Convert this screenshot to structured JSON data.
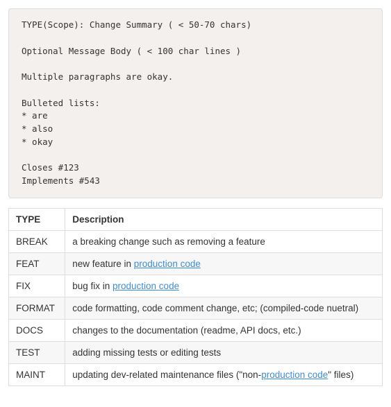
{
  "code_block": "TYPE(Scope): Change Summary ( < 50-70 chars)\n\nOptional Message Body ( < 100 char lines )\n\nMultiple paragraphs are okay.\n\nBulleted lists:\n* are\n* also\n* okay\n\nCloses #123\nImplements #543",
  "table": {
    "headers": {
      "type": "TYPE",
      "description": "Description"
    },
    "rows": [
      {
        "type": "BREAK",
        "desc_pre": "a breaking change such as removing a feature",
        "link": "",
        "desc_post": ""
      },
      {
        "type": "FEAT",
        "desc_pre": "new feature in ",
        "link": "production code",
        "desc_post": ""
      },
      {
        "type": "FIX",
        "desc_pre": "bug fix in ",
        "link": "production code",
        "desc_post": ""
      },
      {
        "type": "FORMAT",
        "desc_pre": "code formatting, code comment change, etc; (compiled-code nuetral)",
        "link": "",
        "desc_post": ""
      },
      {
        "type": "DOCS",
        "desc_pre": "changes to the documentation (readme, API docs, etc.)",
        "link": "",
        "desc_post": ""
      },
      {
        "type": "TEST",
        "desc_pre": "adding missing tests or editing tests",
        "link": "",
        "desc_post": ""
      },
      {
        "type": "MAINT",
        "desc_pre": "updating dev-related maintenance files (\"non-",
        "link": "production code",
        "desc_post": "\" files)"
      }
    ]
  }
}
